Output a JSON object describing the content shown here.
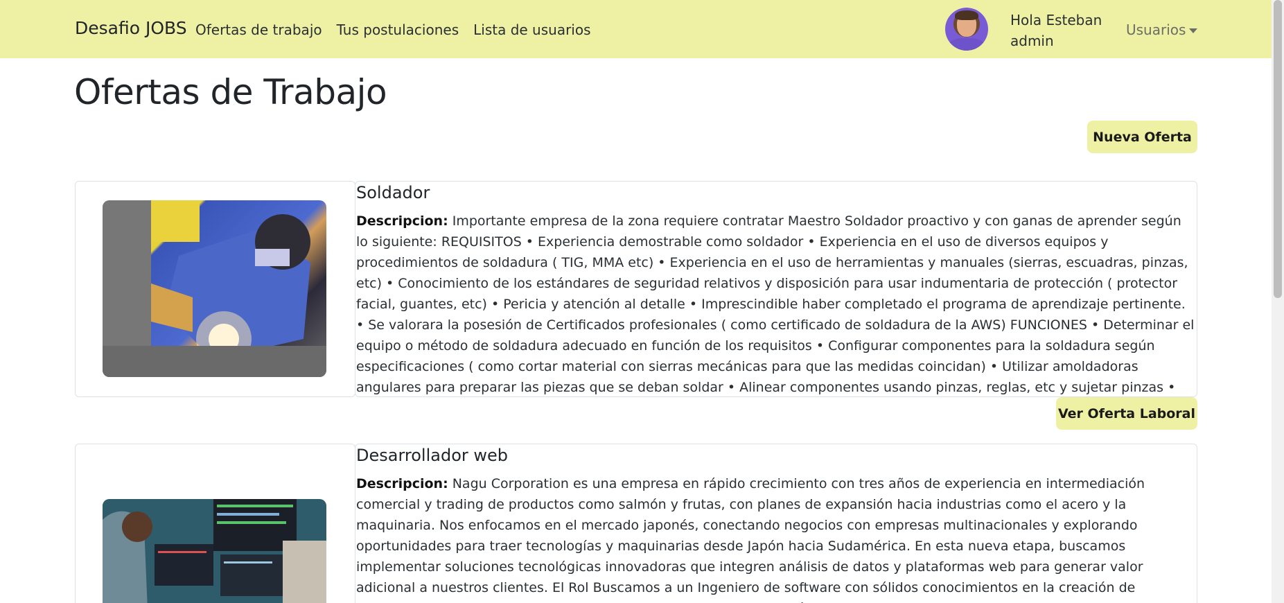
{
  "navbar": {
    "brand": "Desafio JOBS",
    "links": [
      "Ofertas de trabajo",
      "Tus postulaciones",
      "Lista de usuarios"
    ],
    "greeting_line1": "Hola Esteban",
    "greeting_line2": "admin",
    "user_menu": "Usuarios",
    "bg_color": "#eef1a4"
  },
  "page": {
    "title": "Ofertas de Trabajo",
    "new_offer_button": "Nueva Oferta",
    "view_offer_button": "Ver Oferta Laboral"
  },
  "jobs": [
    {
      "title": "Soldador",
      "desc_label": "Descripcion:",
      "description": "Importante empresa de la zona requiere contratar Maestro Soldador proactivo y con ganas de aprender según lo siguiente: REQUISITOS • Experiencia demostrable como soldador • Experiencia en el uso de diversos equipos y procedimientos de soldadura ( TIG, MMA etc) • Experiencia en el uso de herramientas y manuales (sierras, escuadras, pinzas, etc) • Conocimiento de los estándares de seguridad relativos y disposición para usar indumentaria de protección ( protector facial, guantes, etc) • Pericia y atención al detalle • Imprescindible haber completado el programa de aprendizaje pertinente. • Se valorara la posesión de Certificados profesionales ( como certificado de soldadura de la AWS) FUNCIONES • Determinar el equipo o método de soldadura adecuado en función de los requisitos • Configurar componentes para la soldadura según especificaciones ( como cortar material con sierras mecánicas para que las medidas coincidan) • Utilizar amoldadoras angulares para preparar las piezas que se deban soldar • Alinear componentes usando pinzas, reglas, etc y sujetar pinzas • Soldar componentes con equipo de soldadura manual o semiautomático en distintas posiciones (vertical, horizontal"
    },
    {
      "title": "Desarrollador web",
      "desc_label": "Descripcion:",
      "description": "Nagu Corporation es una empresa en rápido crecimiento con tres años de experiencia en intermediación comercial y trading de productos como salmón y frutas, con planes de expansión hacia industrias como el acero y la maquinaria. Nos enfocamos en el mercado japonés, conectando negocios con empresas multinacionales y explorando oportunidades para traer tecnologías y maquinarias desde Japón hacia Sudamérica. En esta nueva etapa, buscamos implementar soluciones tecnológicas innovadoras que integren análisis de datos y plataformas web para generar valor adicional a nuestros clientes. El Rol Buscamos a un Ingeniero de software con sólidos conocimientos en la creación de plataformas digitales y en bases de datos relacionales. Este rol será crucial para desarrollar"
    }
  ]
}
